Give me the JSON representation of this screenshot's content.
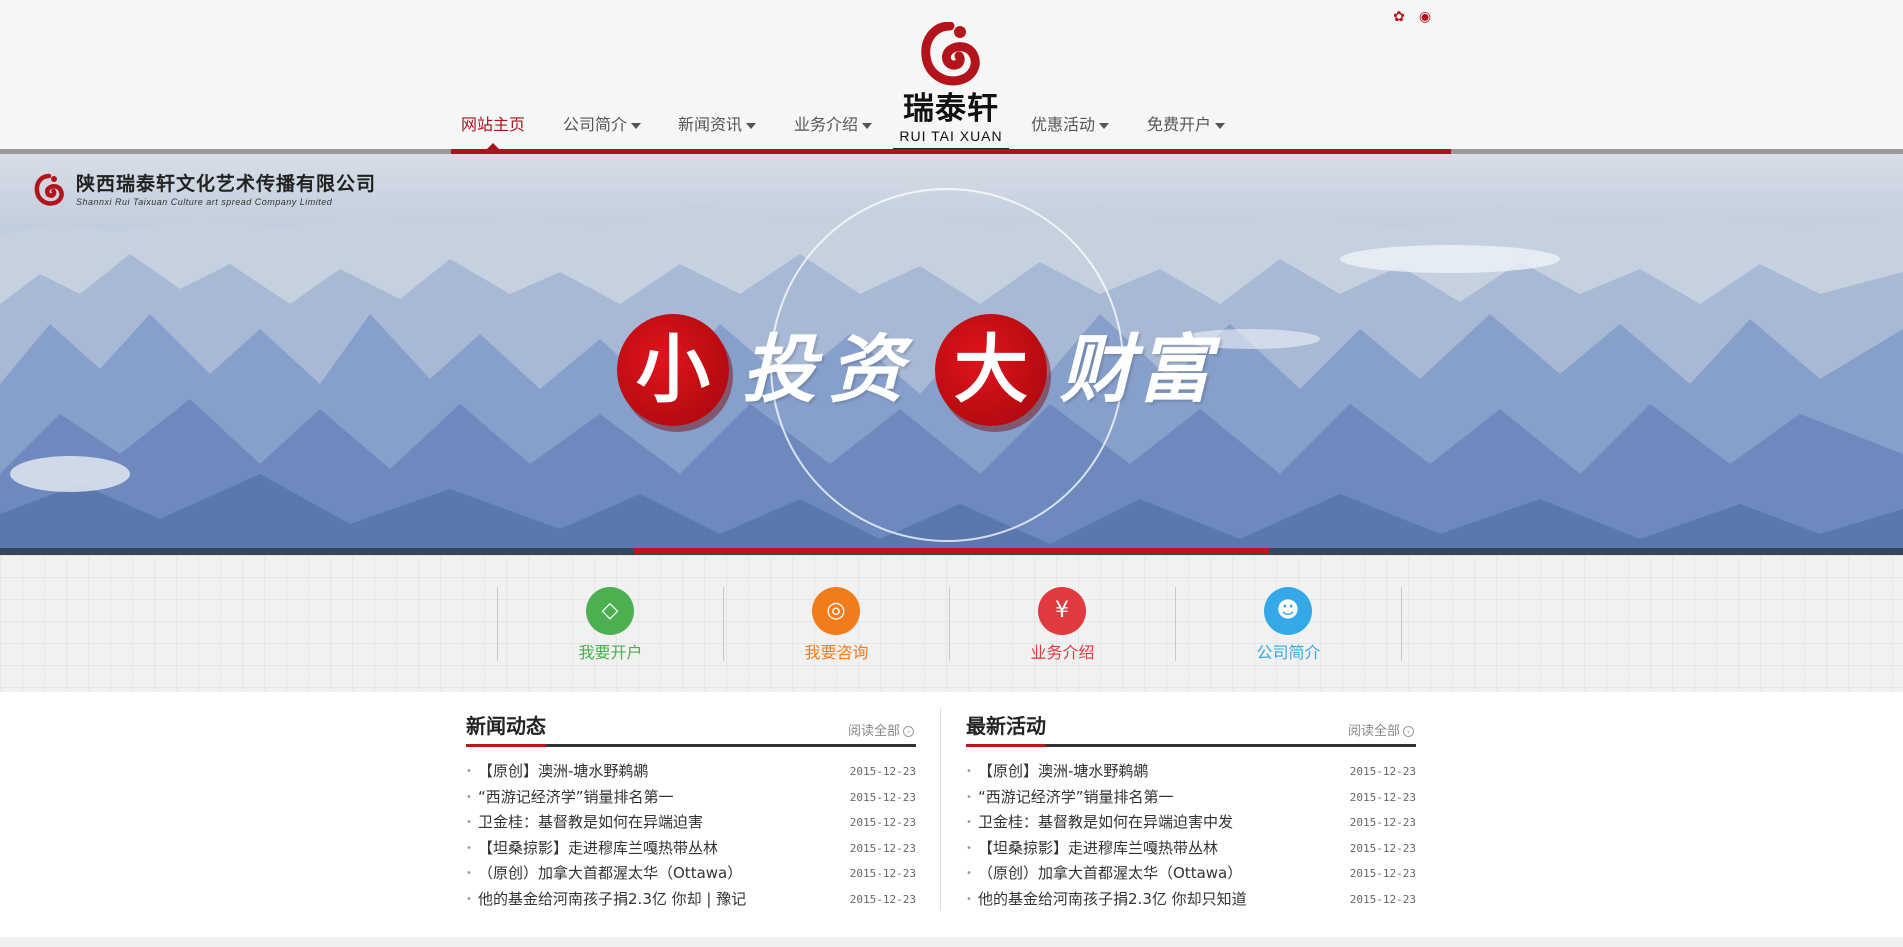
{
  "header": {
    "social": [
      {
        "name": "wechat-icon",
        "glyph": "✿"
      },
      {
        "name": "weibo-icon",
        "glyph": "◉"
      }
    ],
    "logo": {
      "cn": "瑞泰轩",
      "en": "RUI TAI XUAN"
    },
    "nav": [
      {
        "label": "网站主页",
        "active": true,
        "dropdown": false
      },
      {
        "label": "公司简介",
        "dropdown": true
      },
      {
        "label": "新闻资讯",
        "dropdown": true
      },
      {
        "label": "业务介绍",
        "dropdown": true
      },
      {
        "label": "优惠活动",
        "dropdown": true
      },
      {
        "label": "免费开户",
        "dropdown": true
      }
    ]
  },
  "banner": {
    "company_cn": "陕西瑞泰轩文化艺术传播有限公司",
    "company_en": "Shannxi Rui Taixuan Culture art spread Company Limited",
    "slogan": [
      "小",
      "投",
      "资",
      "大",
      "财",
      "富"
    ]
  },
  "quick_links": [
    {
      "label": "我要开户",
      "icon": "diamond-icon",
      "glyph": "◇",
      "color": "#4caf50"
    },
    {
      "label": "我要咨询",
      "icon": "chat-icon",
      "glyph": "◎",
      "color": "#f07c1c"
    },
    {
      "label": "业务介绍",
      "icon": "yen-icon",
      "glyph": "¥",
      "color": "#e0393e"
    },
    {
      "label": "公司简介",
      "icon": "users-icon",
      "glyph": "☻",
      "color": "#35a8e8"
    }
  ],
  "colors": {
    "accent": "#a8131d",
    "banner_red": "#c2131a"
  },
  "news": {
    "title": "新闻动态",
    "more": "阅读全部",
    "items": [
      {
        "title": "【原创】澳洲-塘水野鹈鹕",
        "date": "2015-12-23"
      },
      {
        "title": "“西游记经济学”销量排名第一",
        "date": "2015-12-23"
      },
      {
        "title": "卫金桂：基督教是如何在异端迫害",
        "date": "2015-12-23"
      },
      {
        "title": "【坦桑掠影】走进穆库兰嘎热带丛林",
        "date": "2015-12-23"
      },
      {
        "title": "（原创）加拿大首都渥太华（Ottawa）",
        "date": "2015-12-23"
      },
      {
        "title": "他的基金给河南孩子捐2.3亿 你却 | 豫记",
        "date": "2015-12-23"
      }
    ]
  },
  "activities": {
    "title": "最新活动",
    "more": "阅读全部",
    "items": [
      {
        "title": "【原创】澳洲-塘水野鹈鹕",
        "date": "2015-12-23"
      },
      {
        "title": "“西游记经济学”销量排名第一",
        "date": "2015-12-23"
      },
      {
        "title": "卫金桂：基督教是如何在异端迫害中发",
        "date": "2015-12-23"
      },
      {
        "title": "【坦桑掠影】走进穆库兰嘎热带丛林",
        "date": "2015-12-23"
      },
      {
        "title": "（原创）加拿大首都渥太华（Ottawa）",
        "date": "2015-12-23"
      },
      {
        "title": "他的基金给河南孩子捐2.3亿 你却只知道",
        "date": "2015-12-23"
      }
    ]
  }
}
